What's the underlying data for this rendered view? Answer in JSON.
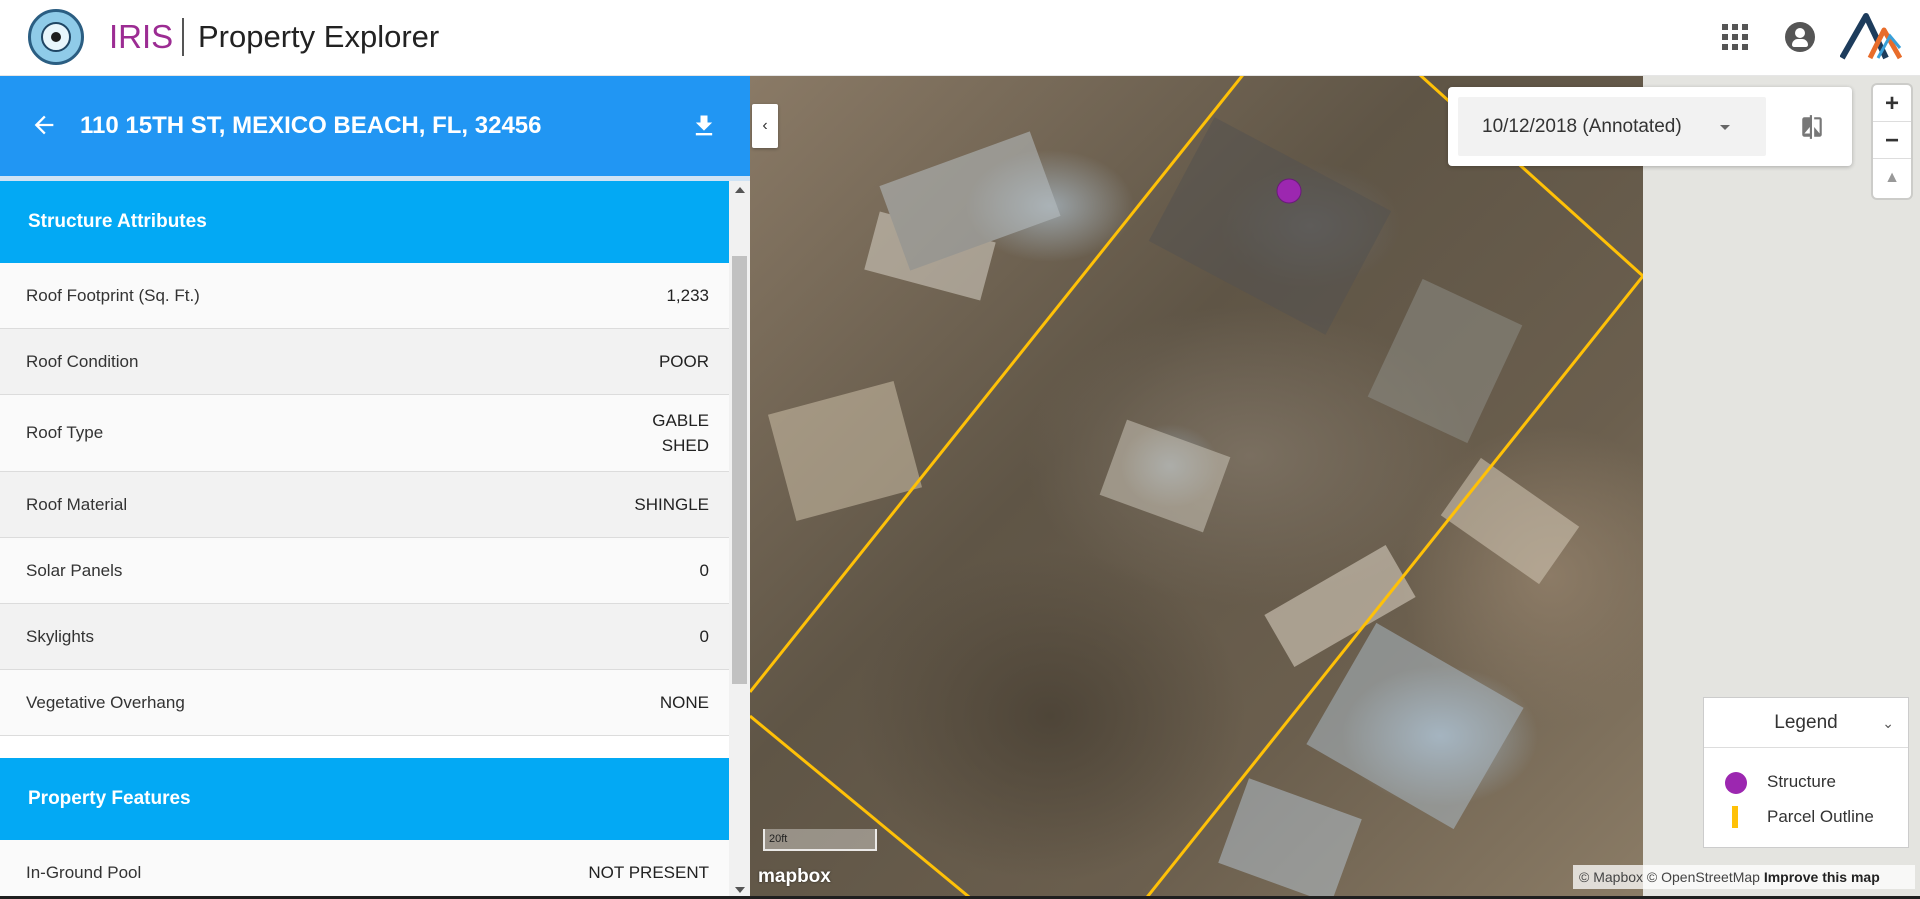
{
  "header": {
    "brand": "IRIS",
    "app_name": "Property Explorer"
  },
  "property": {
    "address": "110 15TH ST, MEXICO BEACH, FL, 32456"
  },
  "sections": [
    {
      "title": "Structure Attributes",
      "rows": [
        {
          "label": "Roof Footprint (Sq. Ft.)",
          "value": "1,233"
        },
        {
          "label": "Roof Condition",
          "value": "POOR"
        },
        {
          "label": "Roof Type",
          "value_lines": [
            "GABLE",
            "SHED"
          ]
        },
        {
          "label": "Roof Material",
          "value": "SHINGLE"
        },
        {
          "label": "Solar Panels",
          "value": "0"
        },
        {
          "label": "Skylights",
          "value": "0"
        },
        {
          "label": "Vegetative Overhang",
          "value": "NONE"
        }
      ]
    },
    {
      "title": "Property Features",
      "rows": [
        {
          "label": "In-Ground Pool",
          "value": "NOT PRESENT"
        }
      ]
    }
  ],
  "map": {
    "imagery_date": "10/12/2018 (Annotated)",
    "zoom_in_label": "+",
    "zoom_out_label": "−",
    "compass_label": "▲",
    "collapse_label": "‹",
    "scale_label": "20ft",
    "mapbox_logo": "mapbox",
    "attribution_a": "© Mapbox © OpenStreetMap",
    "attribution_b": "Improve this map"
  },
  "legend": {
    "title": "Legend",
    "items": [
      {
        "label": "Structure",
        "color": "#9c27b0"
      },
      {
        "label": "Parcel Outline",
        "color": "#ffc107"
      }
    ]
  },
  "colors": {
    "brand": "#9c2c93",
    "address_bar": "#2196f3",
    "section_header": "#03a9f4",
    "structure_marker": "#9c27b0",
    "parcel_outline": "#ffc107"
  },
  "icons": {
    "back": "arrow-left-icon",
    "download": "download-icon",
    "apps": "apps-grid-icon",
    "account": "account-circle-icon",
    "compare": "compare-icon"
  }
}
